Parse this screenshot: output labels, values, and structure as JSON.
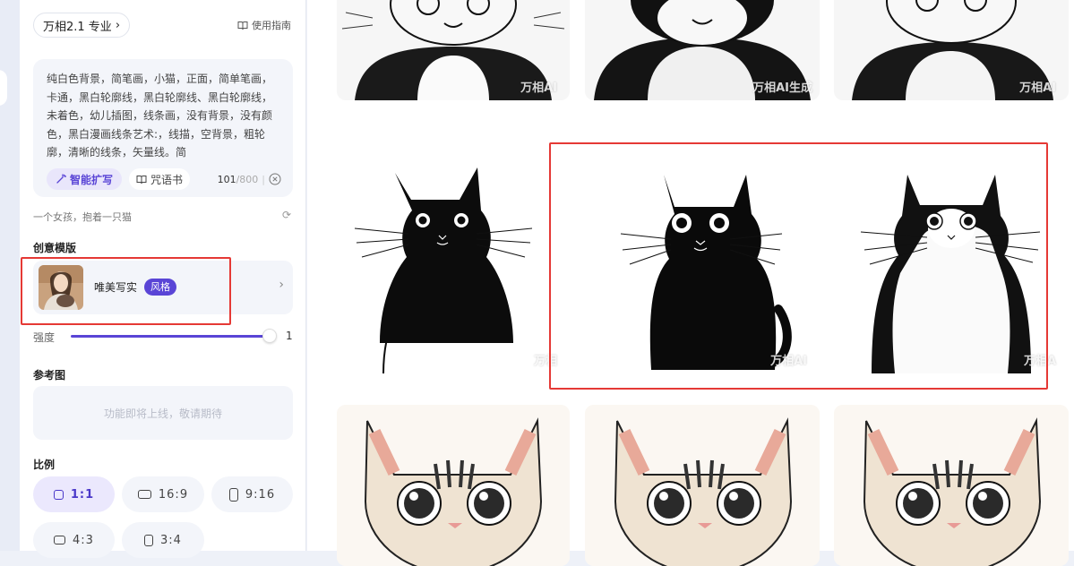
{
  "sidebar": {
    "model_label": "万相2.1 专业",
    "guide_label": "使用指南",
    "prompt": {
      "text": "纯白色背景，简笔画，小猫，正面，简单笔画，卡通，黑白轮廓线，黑白轮廓线、黑白轮廓线，未着色，幼儿插图，线条画，没有背景，没有颜色，黑白漫画线条艺术:，线描，空背景，粗轮廓，清晰的线条，矢量线。简",
      "expand_label": "智能扩写",
      "spellbook_label": "咒语书",
      "count": "101",
      "max": "/800"
    },
    "suggestion": "一个女孩，抱着一只猫",
    "template_section_title": "创意模版",
    "template": {
      "name": "唯美写实",
      "badge": "风格"
    },
    "strength_label": "强度",
    "strength_value": "1",
    "strength_fraction": 1.0,
    "reference_title": "参考图",
    "reference_placeholder": "功能即将上线，敬请期待",
    "ratio_title": "比例",
    "ratios": [
      {
        "label": "1:1",
        "active": true
      },
      {
        "label": "16:9",
        "active": false
      },
      {
        "label": "9:16",
        "active": false
      },
      {
        "label": "4:3",
        "active": false
      },
      {
        "label": "3:4",
        "active": false
      }
    ]
  },
  "gallery": {
    "watermark": "万相AI生成",
    "watermark_partial_1": "万相AI",
    "watermark_partial_2": "万相AI生成",
    "watermark_partial_3": "万相AI",
    "watermark_mid_1": "万相",
    "watermark_mid_2": "万相AI",
    "watermark_mid_3": "万相A"
  },
  "colors": {
    "accent": "#5a45d6",
    "highlight": "#e53935"
  }
}
